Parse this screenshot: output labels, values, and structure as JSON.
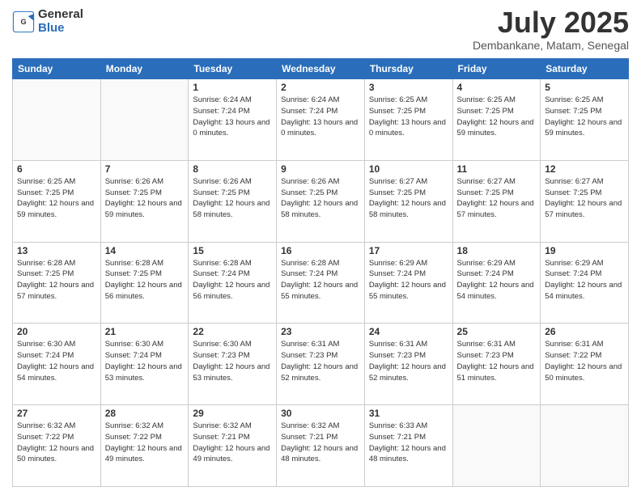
{
  "header": {
    "logo": {
      "general": "General",
      "blue": "Blue"
    },
    "title": "July 2025",
    "location": "Dembankane, Matam, Senegal"
  },
  "calendar": {
    "days": [
      "Sunday",
      "Monday",
      "Tuesday",
      "Wednesday",
      "Thursday",
      "Friday",
      "Saturday"
    ],
    "weeks": [
      [
        {
          "day": null
        },
        {
          "day": null
        },
        {
          "day": 1,
          "sunrise": "6:24 AM",
          "sunset": "7:24 PM",
          "daylight": "13 hours and 0 minutes."
        },
        {
          "day": 2,
          "sunrise": "6:24 AM",
          "sunset": "7:24 PM",
          "daylight": "13 hours and 0 minutes."
        },
        {
          "day": 3,
          "sunrise": "6:25 AM",
          "sunset": "7:25 PM",
          "daylight": "13 hours and 0 minutes."
        },
        {
          "day": 4,
          "sunrise": "6:25 AM",
          "sunset": "7:25 PM",
          "daylight": "12 hours and 59 minutes."
        },
        {
          "day": 5,
          "sunrise": "6:25 AM",
          "sunset": "7:25 PM",
          "daylight": "12 hours and 59 minutes."
        }
      ],
      [
        {
          "day": 6,
          "sunrise": "6:25 AM",
          "sunset": "7:25 PM",
          "daylight": "12 hours and 59 minutes."
        },
        {
          "day": 7,
          "sunrise": "6:26 AM",
          "sunset": "7:25 PM",
          "daylight": "12 hours and 59 minutes."
        },
        {
          "day": 8,
          "sunrise": "6:26 AM",
          "sunset": "7:25 PM",
          "daylight": "12 hours and 58 minutes."
        },
        {
          "day": 9,
          "sunrise": "6:26 AM",
          "sunset": "7:25 PM",
          "daylight": "12 hours and 58 minutes."
        },
        {
          "day": 10,
          "sunrise": "6:27 AM",
          "sunset": "7:25 PM",
          "daylight": "12 hours and 58 minutes."
        },
        {
          "day": 11,
          "sunrise": "6:27 AM",
          "sunset": "7:25 PM",
          "daylight": "12 hours and 57 minutes."
        },
        {
          "day": 12,
          "sunrise": "6:27 AM",
          "sunset": "7:25 PM",
          "daylight": "12 hours and 57 minutes."
        }
      ],
      [
        {
          "day": 13,
          "sunrise": "6:28 AM",
          "sunset": "7:25 PM",
          "daylight": "12 hours and 57 minutes."
        },
        {
          "day": 14,
          "sunrise": "6:28 AM",
          "sunset": "7:25 PM",
          "daylight": "12 hours and 56 minutes."
        },
        {
          "day": 15,
          "sunrise": "6:28 AM",
          "sunset": "7:24 PM",
          "daylight": "12 hours and 56 minutes."
        },
        {
          "day": 16,
          "sunrise": "6:28 AM",
          "sunset": "7:24 PM",
          "daylight": "12 hours and 55 minutes."
        },
        {
          "day": 17,
          "sunrise": "6:29 AM",
          "sunset": "7:24 PM",
          "daylight": "12 hours and 55 minutes."
        },
        {
          "day": 18,
          "sunrise": "6:29 AM",
          "sunset": "7:24 PM",
          "daylight": "12 hours and 54 minutes."
        },
        {
          "day": 19,
          "sunrise": "6:29 AM",
          "sunset": "7:24 PM",
          "daylight": "12 hours and 54 minutes."
        }
      ],
      [
        {
          "day": 20,
          "sunrise": "6:30 AM",
          "sunset": "7:24 PM",
          "daylight": "12 hours and 54 minutes."
        },
        {
          "day": 21,
          "sunrise": "6:30 AM",
          "sunset": "7:24 PM",
          "daylight": "12 hours and 53 minutes."
        },
        {
          "day": 22,
          "sunrise": "6:30 AM",
          "sunset": "7:23 PM",
          "daylight": "12 hours and 53 minutes."
        },
        {
          "day": 23,
          "sunrise": "6:31 AM",
          "sunset": "7:23 PM",
          "daylight": "12 hours and 52 minutes."
        },
        {
          "day": 24,
          "sunrise": "6:31 AM",
          "sunset": "7:23 PM",
          "daylight": "12 hours and 52 minutes."
        },
        {
          "day": 25,
          "sunrise": "6:31 AM",
          "sunset": "7:23 PM",
          "daylight": "12 hours and 51 minutes."
        },
        {
          "day": 26,
          "sunrise": "6:31 AM",
          "sunset": "7:22 PM",
          "daylight": "12 hours and 50 minutes."
        }
      ],
      [
        {
          "day": 27,
          "sunrise": "6:32 AM",
          "sunset": "7:22 PM",
          "daylight": "12 hours and 50 minutes."
        },
        {
          "day": 28,
          "sunrise": "6:32 AM",
          "sunset": "7:22 PM",
          "daylight": "12 hours and 49 minutes."
        },
        {
          "day": 29,
          "sunrise": "6:32 AM",
          "sunset": "7:21 PM",
          "daylight": "12 hours and 49 minutes."
        },
        {
          "day": 30,
          "sunrise": "6:32 AM",
          "sunset": "7:21 PM",
          "daylight": "12 hours and 48 minutes."
        },
        {
          "day": 31,
          "sunrise": "6:33 AM",
          "sunset": "7:21 PM",
          "daylight": "12 hours and 48 minutes."
        },
        {
          "day": null
        },
        {
          "day": null
        }
      ]
    ]
  }
}
